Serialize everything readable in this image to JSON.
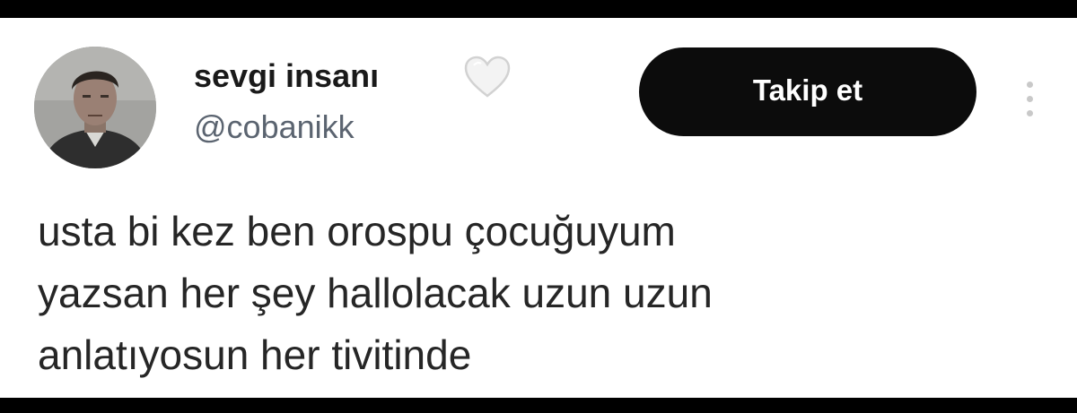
{
  "user": {
    "display_name": "sevgi insanı",
    "handle": "@cobanikk",
    "badge_icon": "white-heart-icon"
  },
  "actions": {
    "follow_label": "Takip et",
    "more_icon": "more-vertical-icon"
  },
  "tweet": {
    "lines": [
      "usta bi kez ben orospu çocuğuyum",
      "yazsan her şey hallolacak uzun uzun",
      "anlatıyosun her tivitinde"
    ]
  },
  "colors": {
    "frame": "#000000",
    "card": "#ffffff",
    "button_bg": "#0c0c0c",
    "button_text": "#ffffff",
    "name_text": "#1a1a1a",
    "handle_text": "#5b6470",
    "body_text": "#262626"
  }
}
